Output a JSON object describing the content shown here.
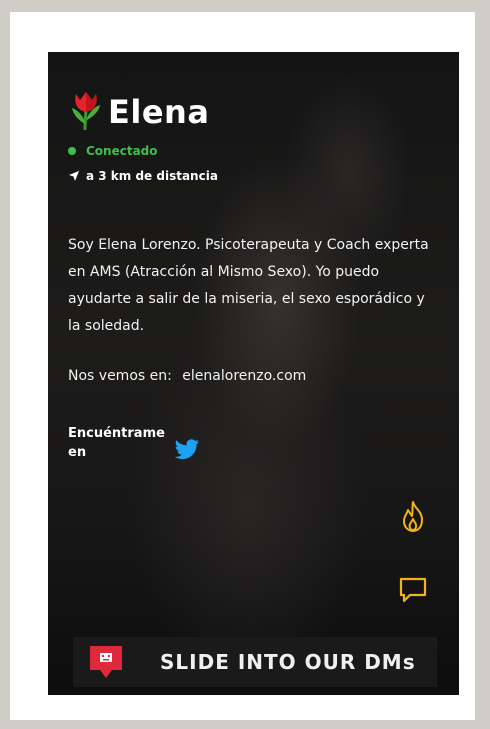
{
  "profile": {
    "name": "Elena",
    "status": "Conectado",
    "distance": "a 3 km de distancia",
    "bio": "Soy Elena Lorenzo. Psicoterapeuta y Coach experta en AMS (Atracción al Mismo Sexo). Yo puedo ayudarte a salir de la miseria, el sexo esporádico y la soledad.",
    "website_label": "Nos vemos en:",
    "website": "elenalorenzo.com",
    "find_label": "Encuéntrame en"
  },
  "icons": {
    "name_icon": "tulip-icon",
    "status_icon": "online-dot-icon",
    "distance_icon": "location-arrow-icon",
    "social_icon": "twitter-icon",
    "action_1": "flame-icon",
    "action_2": "chat-icon",
    "banner_icon": "dm-bubble-icon"
  },
  "banner": {
    "text": "SLIDE INTO OUR DMs"
  },
  "colors": {
    "online": "#3fbf4a",
    "action_icons": "#f2b21b",
    "twitter": "#1da1f2",
    "banner_icon": "#e0283b"
  }
}
